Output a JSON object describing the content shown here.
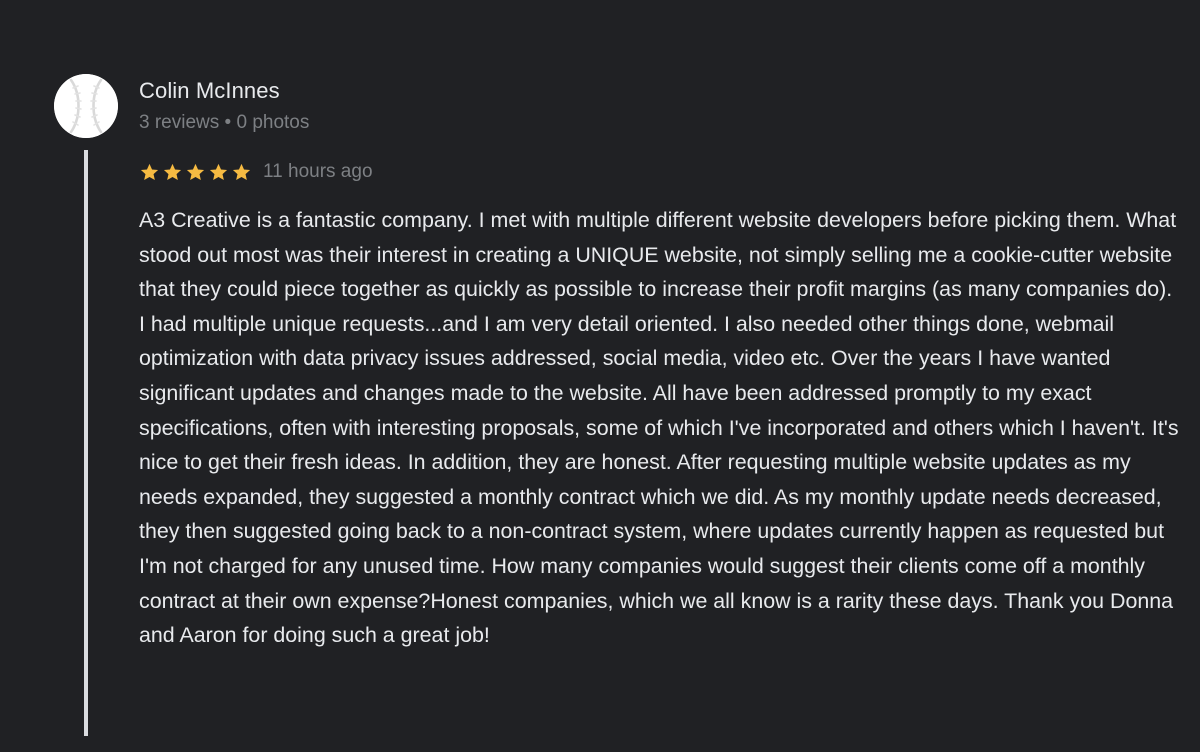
{
  "review": {
    "author": {
      "name": "Colin McInnes",
      "reviews_count": "3 reviews",
      "separator": "•",
      "photos_count": "0 photos",
      "avatar_icon": "baseball-icon"
    },
    "rating": {
      "stars": 5,
      "max_stars": 5,
      "star_color": "#f6bb42",
      "star_icon": "star-icon"
    },
    "time_ago": "11 hours ago",
    "text": "A3 Creative is a fantastic company. I met with multiple different website developers before picking them. What stood out most was their interest in creating a UNIQUE website, not simply selling me a cookie-cutter website that they could piece together as quickly as possible to increase their profit margins (as many companies do). I had multiple unique requests...and I am very detail oriented. I also needed other things done, webmail optimization with data privacy issues addressed, social media, video etc. Over the years I have wanted significant updates and changes made to the website. All have been addressed promptly to my exact specifications, often with interesting proposals, some of which I've incorporated and others which I haven't. It's nice to get their fresh ideas. In addition, they are honest. After requesting multiple website updates as my needs expanded, they suggested a monthly contract which we did. As my monthly update needs decreased, they then suggested going back to a non-contract system, where updates currently happen as requested but I'm not charged for any unused time. How many companies would suggest their clients come off a monthly contract at their own expense?Honest companies, which we all know is a rarity these days. Thank you Donna and Aaron for doing such a great job!"
  },
  "colors": {
    "background": "#202124",
    "primary_text": "#e8eaed",
    "secondary_text": "#7d8084",
    "thread_line": "#dadce0"
  }
}
